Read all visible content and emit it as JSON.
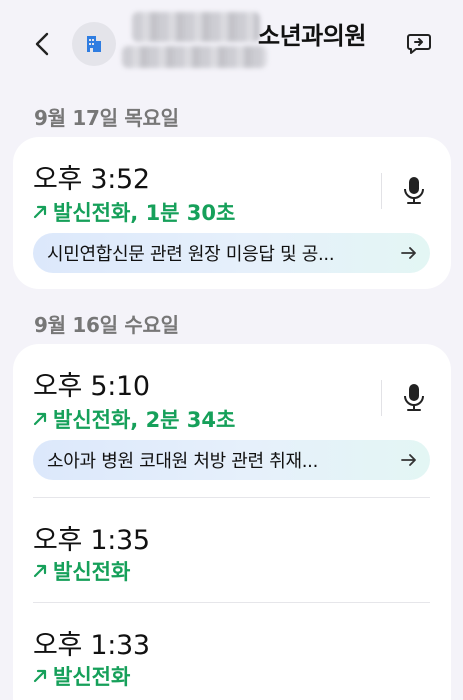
{
  "header": {
    "contact_name": "소년과의원",
    "back_icon": "chevron-left-icon",
    "avatar_icon": "building-icon",
    "message_icon": "message-bubble-icon"
  },
  "sections": [
    {
      "date": "9월 17일 목요일",
      "calls": [
        {
          "time": "오후 3:52",
          "type": "발신전화, 1분 30초",
          "summary": "시민연합신문 관련 원장 미응답 및 공...",
          "has_recording": true
        }
      ]
    },
    {
      "date": "9월 16일 수요일",
      "calls": [
        {
          "time": "오후 5:10",
          "type": "발신전화, 2분 34초",
          "summary": "소아과 병원 코대원 처방 관련 취재...",
          "has_recording": true
        },
        {
          "time": "오후 1:35",
          "type": "발신전화"
        },
        {
          "time": "오후 1:33",
          "type": "발신전화"
        }
      ]
    }
  ],
  "colors": {
    "background": "#f4f3f9",
    "card": "#ffffff",
    "outgoing_green": "#16a05a",
    "date_gray": "#777777"
  }
}
